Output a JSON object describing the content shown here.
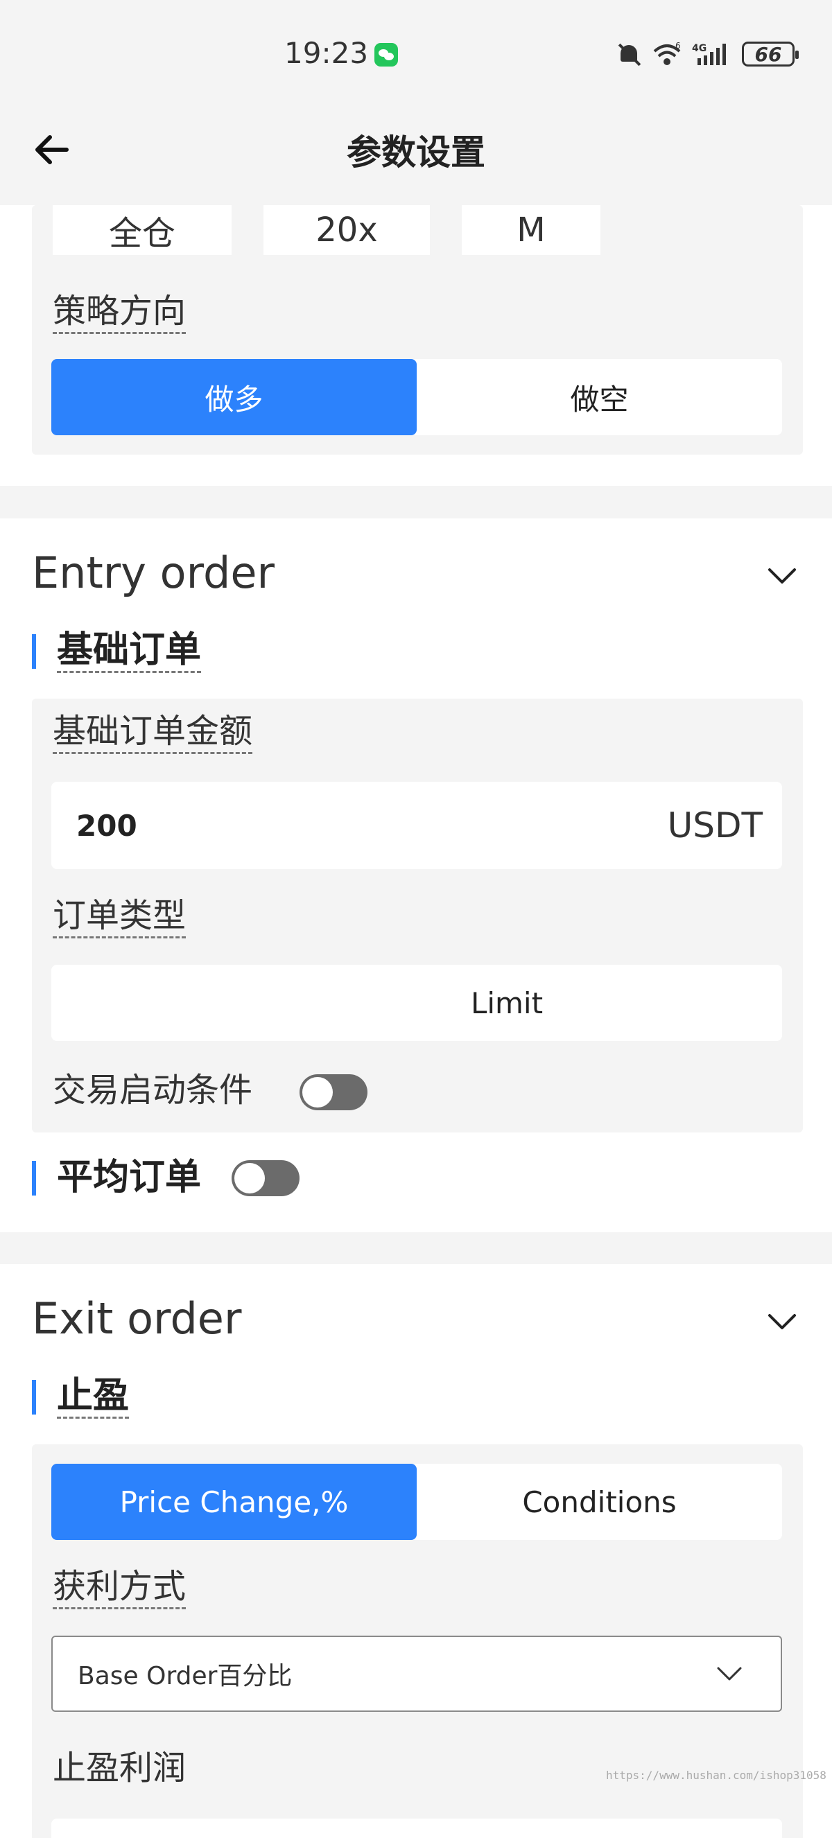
{
  "status_bar": {
    "time": "19:23",
    "wifi_label": "6",
    "network_label": "4G",
    "battery": "66"
  },
  "header": {
    "title": "参数设置"
  },
  "top_section": {
    "chips": [
      "全仓",
      "20x",
      "M"
    ],
    "direction_label": "策略方向",
    "direction_options": [
      "做多",
      "做空"
    ],
    "direction_selected": "做多"
  },
  "entry_order": {
    "title": "Entry order",
    "base_order": {
      "heading": "基础订单",
      "amount_label": "基础订单金额",
      "amount_value": "200",
      "amount_unit": "USDT",
      "type_label": "订单类型",
      "type_value": "Limit",
      "start_condition_label": "交易启动条件",
      "start_condition_enabled": false
    },
    "average_order": {
      "heading": "平均订单",
      "enabled": false
    }
  },
  "exit_order": {
    "title": "Exit order",
    "take_profit": {
      "heading": "止盈",
      "mode_options": [
        "Price Change,%",
        "Conditions"
      ],
      "mode_selected": "Price Change,%",
      "profit_method_label": "获利方式",
      "profit_method_value": "Base Order百分比",
      "profit_label": "止盈利润"
    }
  },
  "watermark": "https://www.hushan.com/ishop31058",
  "colors": {
    "accent": "#2c82fc",
    "toggle_off": "#6b6b6b",
    "panel": "#f4f4f4"
  }
}
